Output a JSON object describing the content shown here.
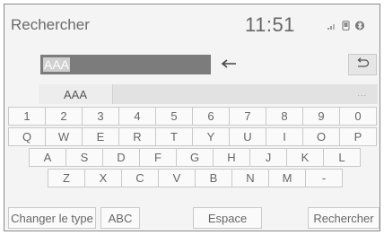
{
  "header": {
    "title": "Rechercher",
    "clock": "11:51",
    "status_icons": [
      "signal-icon",
      "phone-icon",
      "bluetooth-icon"
    ]
  },
  "input": {
    "value": "AAA",
    "backspace_icon": "backspace-arrow-icon",
    "undo_icon": "return-icon"
  },
  "suggestions": {
    "items": [
      "AAA"
    ],
    "more": "..."
  },
  "keyboard": {
    "row1": [
      "1",
      "2",
      "3",
      "4",
      "5",
      "6",
      "7",
      "8",
      "9",
      "0"
    ],
    "row2": [
      "Q",
      "W",
      "E",
      "R",
      "T",
      "Y",
      "U",
      "I",
      "O",
      "P"
    ],
    "row3": [
      "A",
      "S",
      "D",
      "F",
      "G",
      "H",
      "J",
      "K",
      "L"
    ],
    "row4": [
      "Z",
      "X",
      "C",
      "V",
      "B",
      "N",
      "M",
      "-"
    ]
  },
  "bottom_bar": {
    "change_type": "Changer le type",
    "abc": "ABC",
    "space": "Espace",
    "search": "Rechercher"
  }
}
